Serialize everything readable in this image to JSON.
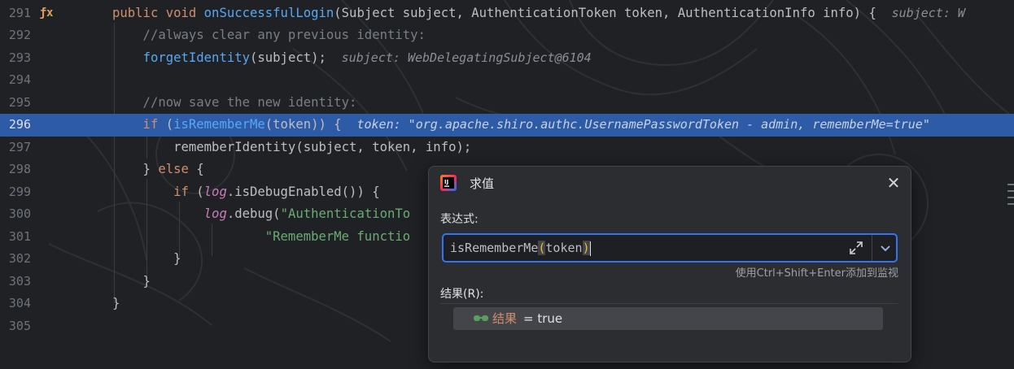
{
  "editor": {
    "lines": [
      {
        "num": "291",
        "tokens": [
          [
            "kw",
            "public void "
          ],
          [
            "fn",
            "onSuccessfulLogin"
          ],
          [
            "pl",
            "(Subject subject, AuthenticationToken token, AuthenticationInfo info) {  "
          ],
          [
            "hint",
            "subject: W"
          ]
        ]
      },
      {
        "num": "292",
        "tokens": [
          [
            "cm",
            "    //always clear any previous identity:"
          ]
        ]
      },
      {
        "num": "293",
        "tokens": [
          [
            "pl",
            "    "
          ],
          [
            "fn",
            "forgetIdentity"
          ],
          [
            "pl",
            "(subject);  "
          ],
          [
            "hint",
            "subject: WebDelegatingSubject@6104"
          ]
        ]
      },
      {
        "num": "294",
        "tokens": []
      },
      {
        "num": "295",
        "tokens": [
          [
            "cm",
            "    //now save the new identity:"
          ]
        ]
      },
      {
        "num": "296",
        "tokens": [
          [
            "kw",
            "    if "
          ],
          [
            "pl",
            "("
          ],
          [
            "fn",
            "isRememberMe"
          ],
          [
            "pl",
            "(token)) {  "
          ],
          [
            "hint",
            "token: \"org.apache.shiro.authc.UsernamePasswordToken - admin, rememberMe=true\""
          ]
        ]
      },
      {
        "num": "297",
        "tokens": [
          [
            "pl",
            "        rememberIdentity(subject, token, info);"
          ]
        ]
      },
      {
        "num": "298",
        "tokens": [
          [
            "pl",
            "    } "
          ],
          [
            "kw",
            "else"
          ],
          [
            "pl",
            " {"
          ]
        ]
      },
      {
        "num": "299",
        "tokens": [
          [
            "kw",
            "        if "
          ],
          [
            "pl",
            "("
          ],
          [
            "fld",
            "log"
          ],
          [
            "pl",
            ".isDebugEnabled()) {"
          ]
        ]
      },
      {
        "num": "300",
        "tokens": [
          [
            "pl",
            "            "
          ],
          [
            "fld",
            "log"
          ],
          [
            "pl",
            ".debug("
          ],
          [
            "str",
            "\"AuthenticationTo"
          ]
        ]
      },
      {
        "num": "301",
        "tokens": [
          [
            "str",
            "                    \"RememberMe functio"
          ]
        ]
      },
      {
        "num": "302",
        "tokens": [
          [
            "pl",
            "        }"
          ]
        ]
      },
      {
        "num": "303",
        "tokens": [
          [
            "pl",
            "    }"
          ]
        ]
      },
      {
        "num": "304",
        "tokens": [
          [
            "pl",
            "}"
          ]
        ]
      },
      {
        "num": "305",
        "tokens": []
      }
    ],
    "gutter_icon": "lambda-icon"
  },
  "evaluate_dialog": {
    "title": "求值",
    "expression_label": "表达式:",
    "expression_value": "isRememberMe(token)",
    "expr_prefix": "isRememberMe",
    "expr_open": "(",
    "expr_arg": "token",
    "expr_close": ")",
    "add_to_watch_hint": "使用Ctrl+Shift+Enter添加到监视",
    "result_label": "结果(R):",
    "result_name": "结果",
    "result_value": "= true"
  },
  "colors": {
    "accent": "#3574f0",
    "execution_line": "#2d5ba6",
    "keyword": "#cf8e6d",
    "method": "#56a8f5",
    "comment": "#7a7e85",
    "string": "#6aab73"
  }
}
